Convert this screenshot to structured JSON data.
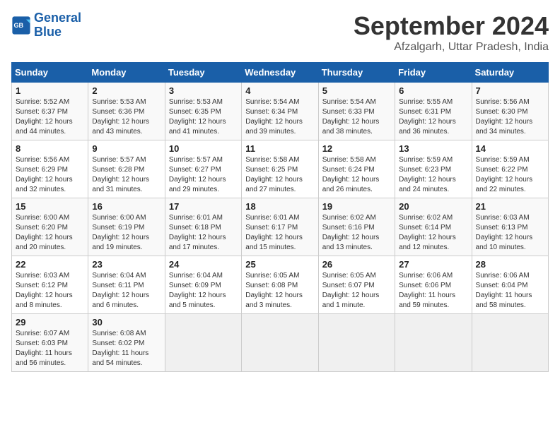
{
  "header": {
    "logo_line1": "General",
    "logo_line2": "Blue",
    "title": "September 2024",
    "subtitle": "Afzalgarh, Uttar Pradesh, India"
  },
  "weekdays": [
    "Sunday",
    "Monday",
    "Tuesday",
    "Wednesday",
    "Thursday",
    "Friday",
    "Saturday"
  ],
  "weeks": [
    [
      {
        "day": "1",
        "sunrise": "5:52 AM",
        "sunset": "6:37 PM",
        "daylight": "12 hours and 44 minutes."
      },
      {
        "day": "2",
        "sunrise": "5:53 AM",
        "sunset": "6:36 PM",
        "daylight": "12 hours and 43 minutes."
      },
      {
        "day": "3",
        "sunrise": "5:53 AM",
        "sunset": "6:35 PM",
        "daylight": "12 hours and 41 minutes."
      },
      {
        "day": "4",
        "sunrise": "5:54 AM",
        "sunset": "6:34 PM",
        "daylight": "12 hours and 39 minutes."
      },
      {
        "day": "5",
        "sunrise": "5:54 AM",
        "sunset": "6:33 PM",
        "daylight": "12 hours and 38 minutes."
      },
      {
        "day": "6",
        "sunrise": "5:55 AM",
        "sunset": "6:31 PM",
        "daylight": "12 hours and 36 minutes."
      },
      {
        "day": "7",
        "sunrise": "5:56 AM",
        "sunset": "6:30 PM",
        "daylight": "12 hours and 34 minutes."
      }
    ],
    [
      {
        "day": "8",
        "sunrise": "5:56 AM",
        "sunset": "6:29 PM",
        "daylight": "12 hours and 32 minutes."
      },
      {
        "day": "9",
        "sunrise": "5:57 AM",
        "sunset": "6:28 PM",
        "daylight": "12 hours and 31 minutes."
      },
      {
        "day": "10",
        "sunrise": "5:57 AM",
        "sunset": "6:27 PM",
        "daylight": "12 hours and 29 minutes."
      },
      {
        "day": "11",
        "sunrise": "5:58 AM",
        "sunset": "6:25 PM",
        "daylight": "12 hours and 27 minutes."
      },
      {
        "day": "12",
        "sunrise": "5:58 AM",
        "sunset": "6:24 PM",
        "daylight": "12 hours and 26 minutes."
      },
      {
        "day": "13",
        "sunrise": "5:59 AM",
        "sunset": "6:23 PM",
        "daylight": "12 hours and 24 minutes."
      },
      {
        "day": "14",
        "sunrise": "5:59 AM",
        "sunset": "6:22 PM",
        "daylight": "12 hours and 22 minutes."
      }
    ],
    [
      {
        "day": "15",
        "sunrise": "6:00 AM",
        "sunset": "6:20 PM",
        "daylight": "12 hours and 20 minutes."
      },
      {
        "day": "16",
        "sunrise": "6:00 AM",
        "sunset": "6:19 PM",
        "daylight": "12 hours and 19 minutes."
      },
      {
        "day": "17",
        "sunrise": "6:01 AM",
        "sunset": "6:18 PM",
        "daylight": "12 hours and 17 minutes."
      },
      {
        "day": "18",
        "sunrise": "6:01 AM",
        "sunset": "6:17 PM",
        "daylight": "12 hours and 15 minutes."
      },
      {
        "day": "19",
        "sunrise": "6:02 AM",
        "sunset": "6:16 PM",
        "daylight": "12 hours and 13 minutes."
      },
      {
        "day": "20",
        "sunrise": "6:02 AM",
        "sunset": "6:14 PM",
        "daylight": "12 hours and 12 minutes."
      },
      {
        "day": "21",
        "sunrise": "6:03 AM",
        "sunset": "6:13 PM",
        "daylight": "12 hours and 10 minutes."
      }
    ],
    [
      {
        "day": "22",
        "sunrise": "6:03 AM",
        "sunset": "6:12 PM",
        "daylight": "12 hours and 8 minutes."
      },
      {
        "day": "23",
        "sunrise": "6:04 AM",
        "sunset": "6:11 PM",
        "daylight": "12 hours and 6 minutes."
      },
      {
        "day": "24",
        "sunrise": "6:04 AM",
        "sunset": "6:09 PM",
        "daylight": "12 hours and 5 minutes."
      },
      {
        "day": "25",
        "sunrise": "6:05 AM",
        "sunset": "6:08 PM",
        "daylight": "12 hours and 3 minutes."
      },
      {
        "day": "26",
        "sunrise": "6:05 AM",
        "sunset": "6:07 PM",
        "daylight": "12 hours and 1 minute."
      },
      {
        "day": "27",
        "sunrise": "6:06 AM",
        "sunset": "6:06 PM",
        "daylight": "11 hours and 59 minutes."
      },
      {
        "day": "28",
        "sunrise": "6:06 AM",
        "sunset": "6:04 PM",
        "daylight": "11 hours and 58 minutes."
      }
    ],
    [
      {
        "day": "29",
        "sunrise": "6:07 AM",
        "sunset": "6:03 PM",
        "daylight": "11 hours and 56 minutes."
      },
      {
        "day": "30",
        "sunrise": "6:08 AM",
        "sunset": "6:02 PM",
        "daylight": "11 hours and 54 minutes."
      },
      null,
      null,
      null,
      null,
      null
    ]
  ]
}
